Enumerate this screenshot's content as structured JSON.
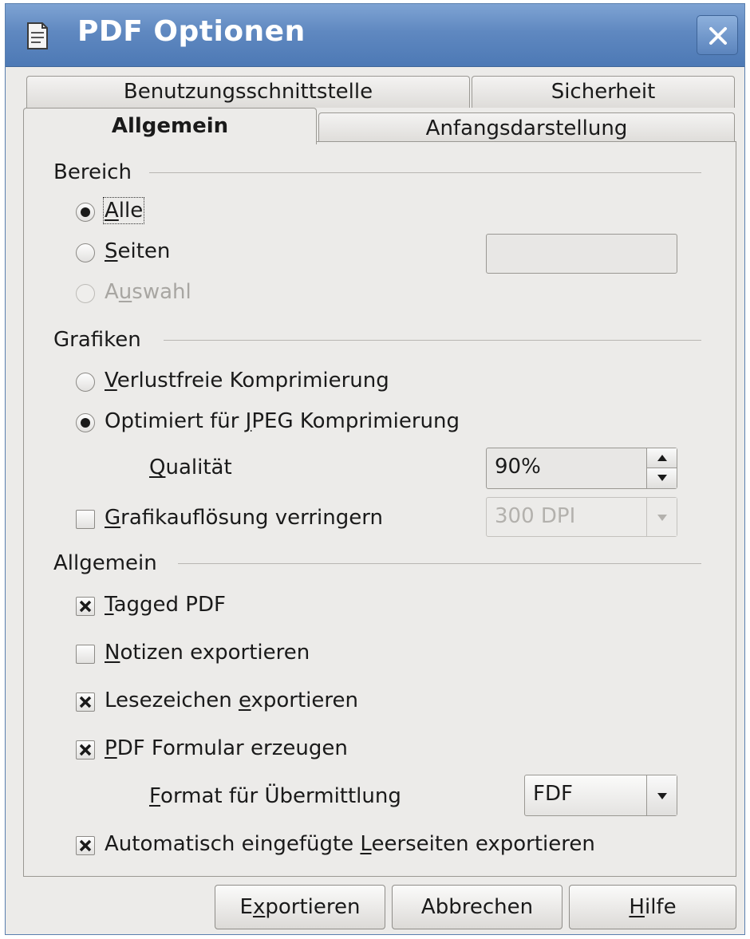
{
  "window": {
    "title": "PDF Optionen",
    "icon": "document-icon",
    "close_icon": "close-icon"
  },
  "tabs": {
    "row1": [
      "Benutzungsschnittstelle",
      "Sicherheit"
    ],
    "row2": [
      "Allgemein",
      "Anfangsdarstellung"
    ],
    "active": "Allgemein"
  },
  "bereich": {
    "label": "Bereich",
    "alle": {
      "pre": "",
      "key": "A",
      "post": "lle",
      "checked": true
    },
    "seiten": {
      "pre": "",
      "key": "S",
      "post": "eiten",
      "checked": false,
      "value": ""
    },
    "auswahl": {
      "pre": "A",
      "key": "u",
      "post": "swahl",
      "checked": false,
      "disabled": true
    }
  },
  "grafiken": {
    "label": "Grafiken",
    "verlustfrei": {
      "pre": "",
      "key": "V",
      "post": "erlustfreie Komprimierung",
      "checked": false
    },
    "jpeg": {
      "pre": "Optimiert für ",
      "key": "J",
      "post": "PEG Komprimierung",
      "checked": true
    },
    "qualitaet": {
      "pre": "",
      "key": "Q",
      "post": "ualität",
      "value": "90%"
    },
    "aufloesung": {
      "pre": "",
      "key": "G",
      "post": "rafikauflösung verringern",
      "checked": false,
      "value": "300 DPI",
      "disabled": true
    }
  },
  "allgemein": {
    "label": "Allgemein",
    "tagged": {
      "pre": "",
      "key": "T",
      "post": "agged PDF",
      "checked": true
    },
    "notizen": {
      "pre": "",
      "key": "N",
      "post": "otizen exportieren",
      "checked": false
    },
    "lesezeichen": {
      "pre": "Lesezeichen ",
      "key": "e",
      "post": "xportieren",
      "checked": true
    },
    "formular": {
      "pre": "",
      "key": "P",
      "post": "DF Formular erzeugen",
      "checked": true
    },
    "format": {
      "pre": "",
      "key": "F",
      "post": "ormat für Übermittlung",
      "value": "FDF"
    },
    "leerseiten": {
      "pre": "Automatisch eingefügte ",
      "key": "L",
      "post": "eerseiten exportieren",
      "checked": true
    }
  },
  "buttons": {
    "export": {
      "pre": "E",
      "key": "x",
      "post": "portieren"
    },
    "cancel": {
      "pre": "Abbrechen",
      "key": "",
      "post": ""
    },
    "help": {
      "pre": "",
      "key": "H",
      "post": "ilfe"
    }
  }
}
